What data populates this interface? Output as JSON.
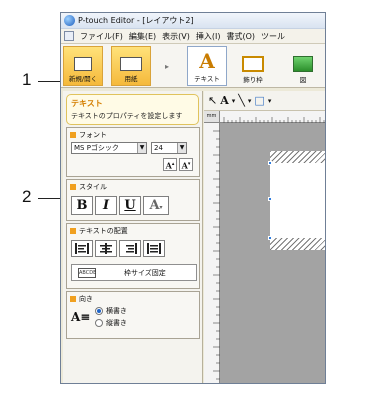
{
  "callouts": {
    "one": "1",
    "two": "2"
  },
  "window": {
    "title": "P-touch Editor - [レイアウト2]"
  },
  "menu": {
    "items": [
      "ファイル(F)",
      "編集(E)",
      "表示(V)",
      "挿入(I)",
      "書式(O)",
      "ツール"
    ]
  },
  "ribbon": {
    "new_label": "新規/開く",
    "paper_label": "用紙",
    "text_label": "テキスト",
    "frame_label": "飾り枠",
    "image_label": "図",
    "text_icon_glyph": "A"
  },
  "pane": {
    "head_title": "テキスト",
    "head_desc": "テキストのプロパティを設定します",
    "font": {
      "title": "フォント",
      "family": "MS Pゴシック",
      "size": "24",
      "grow": "A",
      "shrink": "A"
    },
    "style": {
      "title": "スタイル",
      "bold": "B",
      "italic": "I",
      "underline": "U",
      "effect": "A"
    },
    "align": {
      "title": "テキストの配置",
      "fixed_label": "枠サイズ固定",
      "fixed_icon_text": "ABCDE"
    },
    "direction": {
      "title": "向き",
      "glyph": "A≡",
      "horizontal": "横書き",
      "vertical": "縦書き",
      "selected": "horizontal"
    }
  },
  "canvas": {
    "ruler_unit": "mm",
    "toolbar_glyphs": [
      "↖",
      "A",
      "▾",
      "╲",
      "▾",
      "□",
      "▾"
    ]
  }
}
